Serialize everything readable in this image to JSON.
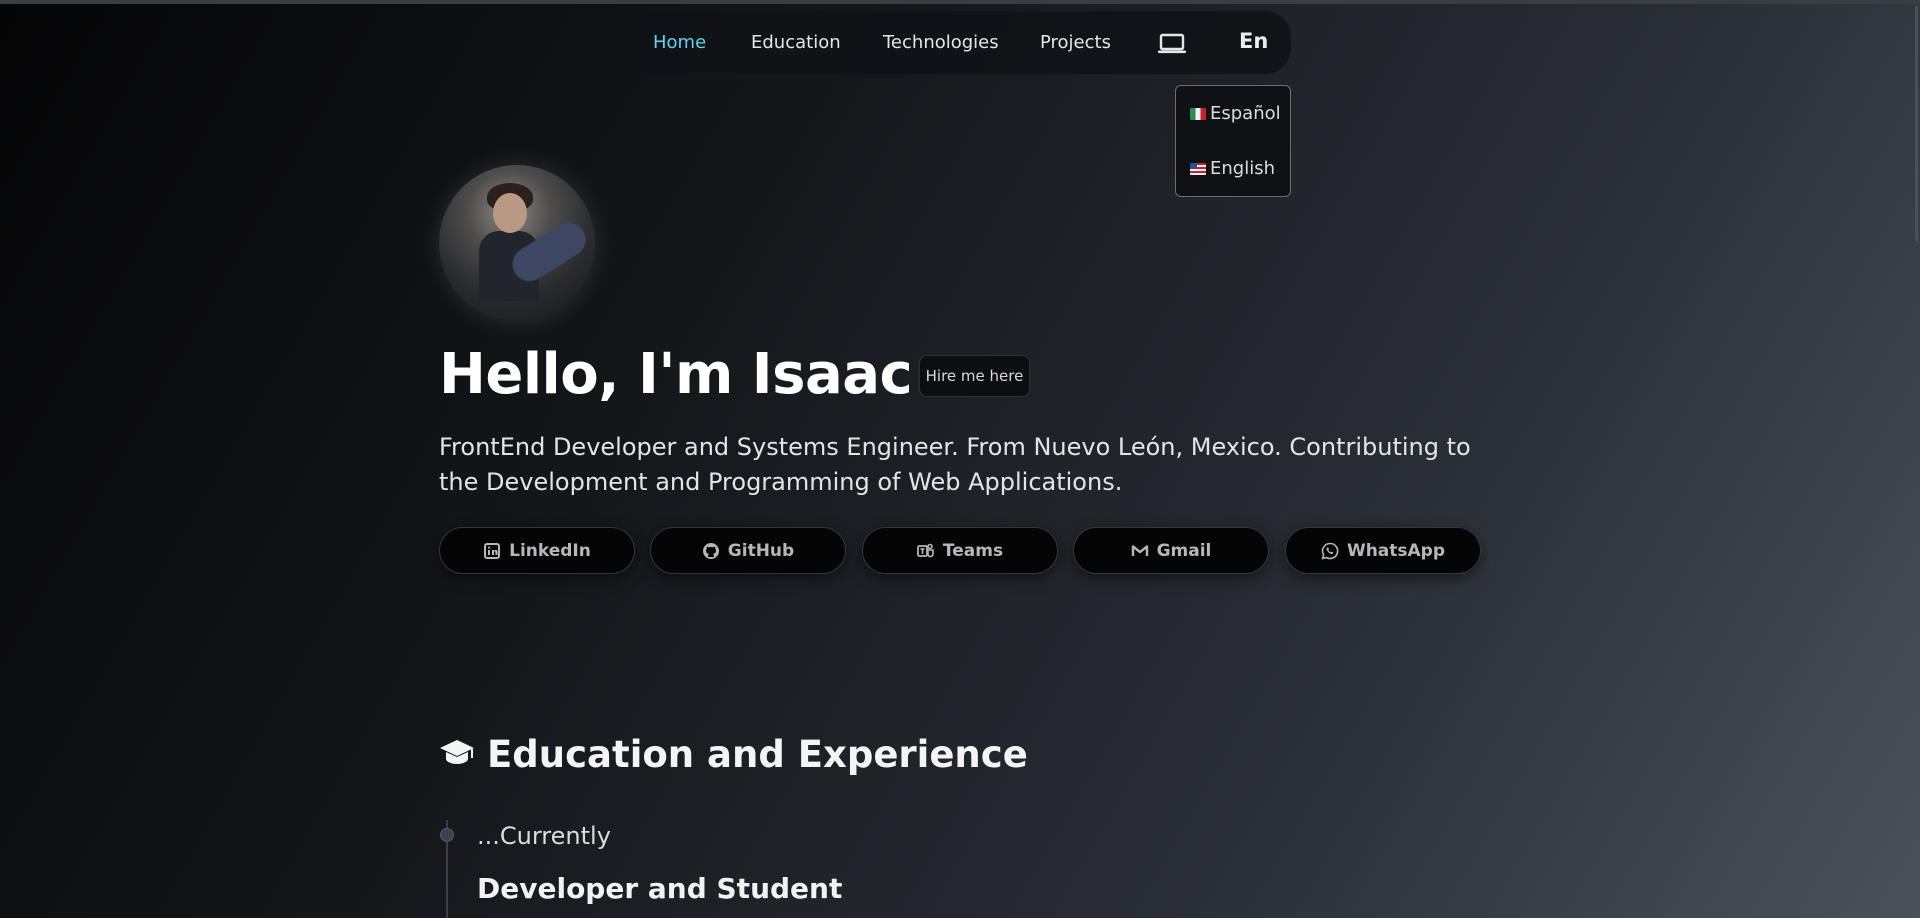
{
  "nav": {
    "items": [
      {
        "label": "Home",
        "active": true
      },
      {
        "label": "Education"
      },
      {
        "label": "Technologies"
      },
      {
        "label": "Projects"
      }
    ],
    "theme_icon": "laptop-icon",
    "language": "En"
  },
  "language_menu": {
    "options": [
      {
        "label": "Español",
        "flag": "mexico-flag-icon"
      },
      {
        "label": "English",
        "flag": "usa-flag-icon"
      }
    ]
  },
  "hero": {
    "title": "Hello, I'm Isaac",
    "hire_button": "Hire me here",
    "bio": "FrontEnd Developer and Systems Engineer. From Nuevo León, Mexico. Contributing to the Development and Programming of Web Applications."
  },
  "social_links": [
    {
      "label": "LinkedIn",
      "icon": "linkedin-icon"
    },
    {
      "label": "GitHub",
      "icon": "github-icon"
    },
    {
      "label": "Teams",
      "icon": "teams-icon"
    },
    {
      "label": "Gmail",
      "icon": "gmail-icon"
    },
    {
      "label": "WhatsApp",
      "icon": "whatsapp-icon"
    }
  ],
  "education": {
    "title": "Education and Experience",
    "icon": "graduation-cap-icon",
    "entries": [
      {
        "date": "...Currently",
        "role": "Developer and Student"
      }
    ]
  },
  "colors": {
    "accent": "#5ad6ee",
    "background_dark": "#050506",
    "background_light": "#4b515b"
  }
}
